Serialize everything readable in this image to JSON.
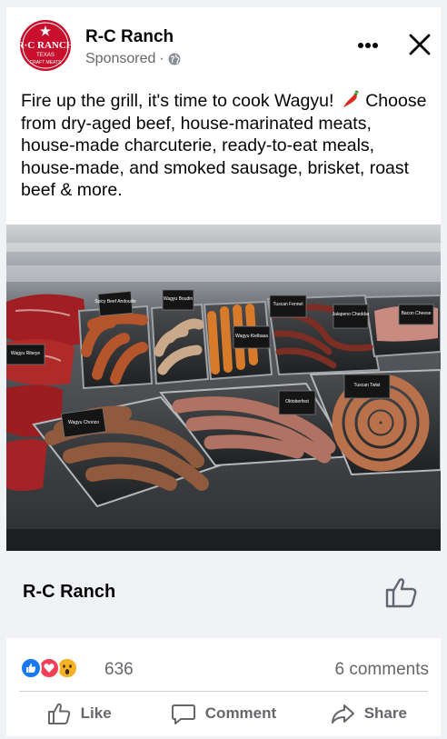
{
  "post": {
    "page_name": "R-C Ranch",
    "sponsored_label": "Sponsored",
    "separator": "·",
    "text": "Fire up the grill, it's time to cook Wagyu!",
    "text_rest": "Choose from dry-aged beef, house-marinated meats, house-made charcuterie, ready-to-eat meals, house-made, and smoked sausage, brisket, roast beef & more.",
    "emoji": "hot-pepper-icon"
  },
  "logo": {
    "top_text": "R·C RANCH",
    "mid_text": "TEXAS",
    "bottom_text": "CRAFT MEATS",
    "color": "#c8102e"
  },
  "photo": {
    "labels": [
      "Spicy Beef Andouille",
      "Wagyu Boudin",
      "Tuscan Fennel",
      "Jalapeno Cheddar",
      "Bacon Cheese",
      "Oktoberfest",
      "Wagyu Kielbasa",
      "Tuscan Twist",
      "Wagyu Ribeye",
      "Wagyu Chorizo"
    ]
  },
  "cta": {
    "title": "R-C Ranch",
    "icon": "thumbs-up-icon"
  },
  "reactions": {
    "count": "636",
    "comments": "6 comments",
    "types": [
      "like",
      "love",
      "wow"
    ]
  },
  "actions": {
    "like": "Like",
    "comment": "Comment",
    "share": "Share"
  },
  "colors": {
    "brand": "#1877f2",
    "text": "#050505",
    "secondary": "#65676b",
    "love": "#f33e58",
    "wow": "#f7b125",
    "cta_bg": "#f0f2f5"
  }
}
